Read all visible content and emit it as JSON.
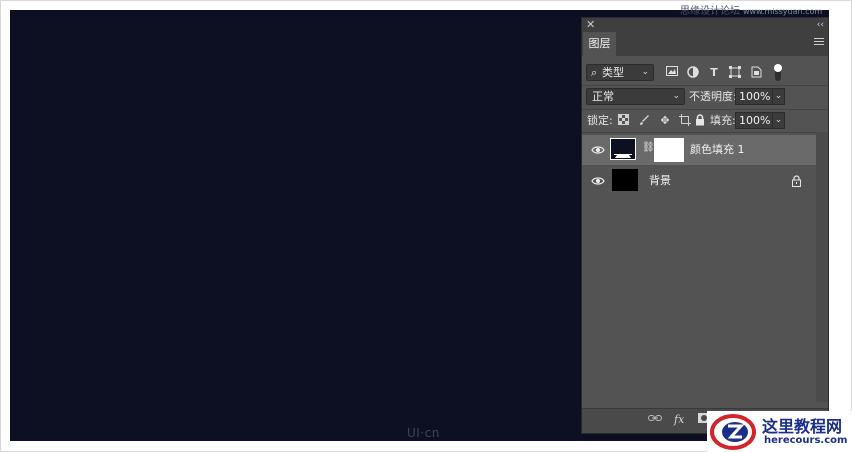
{
  "watermarks": {
    "top_cn": "思缘设计论坛",
    "top_url": "www.missyuan.com",
    "canvas_mark": "UI·cn"
  },
  "layers_panel": {
    "tab_label": "图层",
    "filter_kind_label": "类型",
    "blend_mode": "正常",
    "opacity_label": "不透明度:",
    "opacity_value": "100%",
    "lock_label": "锁定:",
    "fill_label": "填充:",
    "fill_value": "100%",
    "filter_icons": [
      "image-filter-icon",
      "adjustment-filter-icon",
      "type-filter-icon",
      "shape-filter-icon",
      "smart-object-filter-icon"
    ],
    "lock_icons": [
      "lock-transparent-icon",
      "lock-image-icon",
      "lock-position-icon",
      "lock-artboard-icon",
      "lock-all-icon"
    ],
    "layers": [
      {
        "name": "颜色填充 1",
        "selected": true,
        "thumb_color": "#0d1022",
        "has_mask": true,
        "locked": false
      },
      {
        "name": "背景",
        "selected": false,
        "thumb_color": "#000000",
        "has_mask": false,
        "locked": true
      }
    ],
    "bottom_icons": [
      "link-layers-icon",
      "fx-icon",
      "add-mask-icon"
    ],
    "fx_label": "fx"
  },
  "site_logo": {
    "cn": "这里教程网",
    "en": "herecours.com"
  },
  "colors": {
    "canvas": "#0d1022",
    "panel": "#535353",
    "panel_dark": "#3f3f3f",
    "selected_row": "#6a6a6a",
    "logo_blue": "#1b2f8a",
    "logo_red": "#d3242b"
  }
}
